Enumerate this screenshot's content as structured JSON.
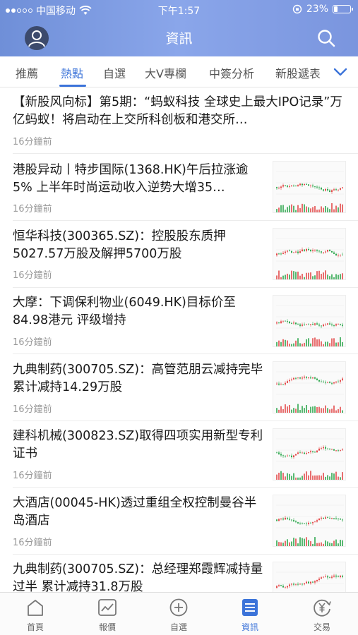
{
  "status_bar": {
    "carrier": "中国移动",
    "time": "下午1:57",
    "battery": "23%",
    "battery_level": 0.23
  },
  "header": {
    "title": "資訊",
    "avatar_icon": "user-icon",
    "search_icon": "search-icon"
  },
  "tabs": {
    "items": [
      {
        "label": "推薦"
      },
      {
        "label": "熱點"
      },
      {
        "label": "自選"
      },
      {
        "label": "大V專欄"
      },
      {
        "label": "中簽分析"
      },
      {
        "label": "新股遞表"
      }
    ],
    "active": "熱點",
    "more_icon": "chevron-down-icon"
  },
  "news": [
    {
      "headline": "【新股风向标】第5期：“蚂蚁科技 全球史上最大IPO记录”万亿蚂蚁！将启动在上交所科创板和港交所…",
      "time": "16分鐘前",
      "has_thumb": false
    },
    {
      "headline": "港股异动丨特步国际(1368.HK)午后拉涨逾5% 上半年时尚运动收入逆势大增35…",
      "time": "16分鐘前",
      "has_thumb": true
    },
    {
      "headline": "恒华科技(300365.SZ)：控股股东质押5027.57万股及解押5700万股",
      "time": "16分鐘前",
      "has_thumb": true
    },
    {
      "headline": "大摩：下调保利物业(6049.HK)目标价至84.98港元 评级增持",
      "time": "16分鐘前",
      "has_thumb": true
    },
    {
      "headline": "九典制药(300705.SZ)：高管范朋云减持完毕 累计减持14.29万股",
      "time": "16分鐘前",
      "has_thumb": true
    },
    {
      "headline": "建科机械(300823.SZ)取得四项实用新型专利证书",
      "time": "16分鐘前",
      "has_thumb": true
    },
    {
      "headline": "大酒店(00045-HK)透过重组全权控制曼谷半岛酒店",
      "time": "16分鐘前",
      "has_thumb": true
    },
    {
      "headline": "九典制药(300705.SZ)：总经理郑霞辉减持量过半 累计减持31.8万股",
      "time": "",
      "has_thumb": true
    }
  ],
  "bottom_nav": {
    "items": [
      {
        "label": "首頁",
        "icon": "home-icon"
      },
      {
        "label": "報價",
        "icon": "chart-icon"
      },
      {
        "label": "自選",
        "icon": "plus-circle-icon"
      },
      {
        "label": "資訊",
        "icon": "news-icon"
      },
      {
        "label": "交易",
        "icon": "yen-trade-icon"
      }
    ],
    "active": "資訊"
  },
  "colors": {
    "accent": "#3b73d9",
    "header_gradient_start": "#6f8fd8",
    "header_gradient_end": "#7a95de",
    "chart_up": "#e44b4b",
    "chart_down": "#2fa84f"
  }
}
